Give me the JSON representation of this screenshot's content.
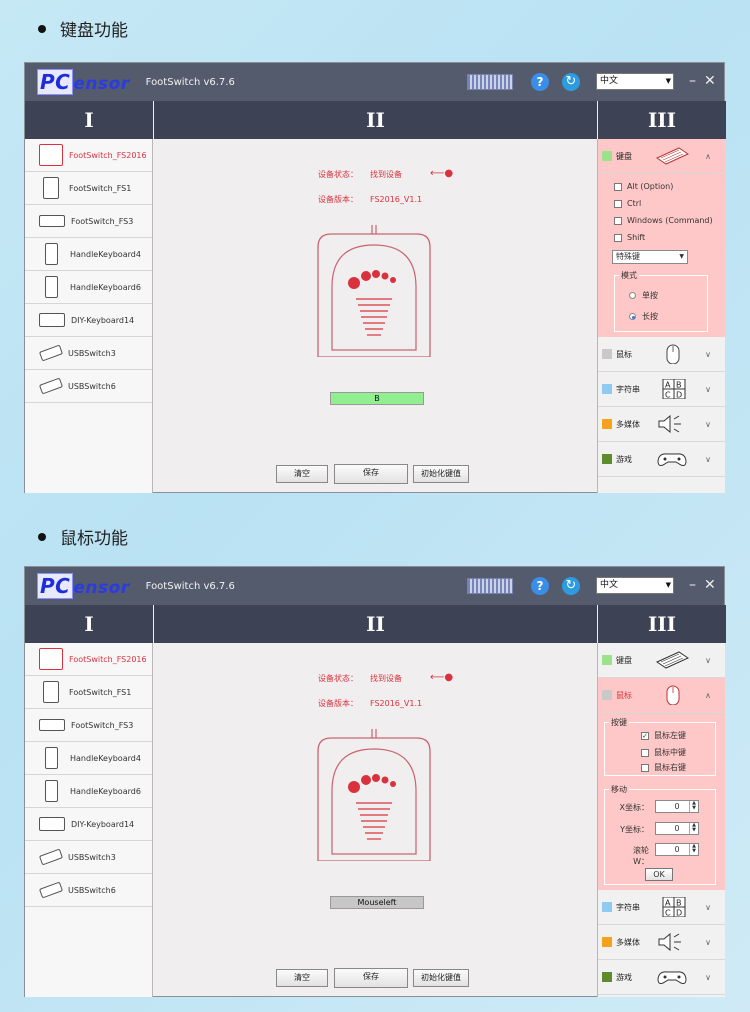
{
  "sections": [
    {
      "title": "键盘功能",
      "app_title": "FootSwitch v6.7.6",
      "logo_first": "PC",
      "logo_rest": "ensor",
      "language": "中文",
      "win_min": "–",
      "win_close": "✕",
      "col_heads": [
        "I",
        "II",
        "III"
      ],
      "devices": [
        "FootSwitch_FS2016",
        "FootSwitch_FS1",
        "FootSwitch_FS3",
        "HandleKeyboard4",
        "HandleKeyboard6",
        "DIY-Keyboard14",
        "USBSwitch3",
        "USBSwitch6"
      ],
      "status_label": "设备状态：",
      "status_value": "找到设备",
      "version_label": "设备版本：",
      "version_value": "FS2016_V1.1",
      "key_value": "B",
      "buttons": {
        "clear": "清空",
        "save": "保存",
        "init": "初始化键值"
      },
      "categories": {
        "keyboard": "键盘",
        "mouse": "鼠标",
        "string": "字符串",
        "media": "多媒体",
        "game": "游戏"
      },
      "keyboard_panel": {
        "checks": [
          "Alt (Option)",
          "Ctrl",
          "Windows (Command)",
          "Shift"
        ],
        "special_key": "特殊键",
        "mode_title": "模式",
        "mode_single": "单按",
        "mode_long": "长按"
      }
    },
    {
      "title": "鼠标功能",
      "app_title": "FootSwitch v6.7.6",
      "logo_first": "PC",
      "logo_rest": "ensor",
      "language": "中文",
      "win_min": "–",
      "win_close": "✕",
      "col_heads": [
        "I",
        "II",
        "III"
      ],
      "devices": [
        "FootSwitch_FS2016",
        "FootSwitch_FS1",
        "FootSwitch_FS3",
        "HandleKeyboard4",
        "HandleKeyboard6",
        "DIY-Keyboard14",
        "USBSwitch3",
        "USBSwitch6"
      ],
      "status_label": "设备状态：",
      "status_value": "找到设备",
      "version_label": "设备版本：",
      "version_value": "FS2016_V1.1",
      "key_value": "Mouseleft",
      "buttons": {
        "clear": "清空",
        "save": "保存",
        "init": "初始化键值"
      },
      "categories": {
        "keyboard": "键盘",
        "mouse": "鼠标",
        "string": "字符串",
        "media": "多媒体",
        "game": "游戏"
      },
      "mouse_panel": {
        "buttons_title": "按键",
        "left": "鼠标左键",
        "middle": "鼠标中键",
        "right": "鼠标右键",
        "move_title": "移动",
        "x_label": "X坐标：",
        "y_label": "Y坐标：",
        "wheel_label": "滚轮W：",
        "x_value": "0",
        "y_value": "0",
        "wheel_value": "0",
        "ok": "OK"
      }
    }
  ],
  "colors": {
    "accent_red": "#d9323e",
    "title_bar": "#545b6d",
    "col_head": "#3d4354",
    "panel_pink": "#ffc8c8",
    "keyboard_sw": "#9be28b",
    "mouse_sw": "#c9c9c9",
    "string_sw": "#8fcbf1",
    "media_sw": "#f5a21c",
    "game_sw": "#5e8c2d"
  }
}
